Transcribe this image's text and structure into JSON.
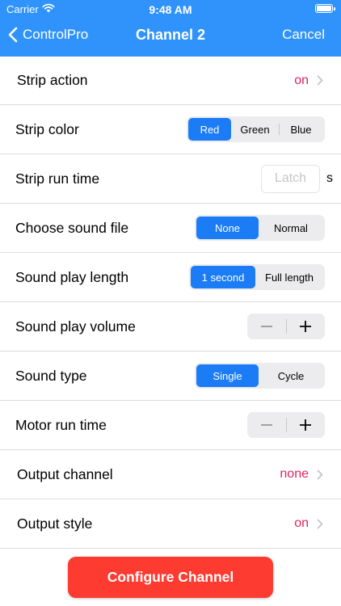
{
  "colors": {
    "header": "#2f93fb",
    "accent": "#1b7cf5",
    "value": "#e0245e",
    "destructive": "#fe3b30"
  },
  "status_bar": {
    "carrier": "Carrier",
    "time": "9:48 AM"
  },
  "nav": {
    "back_label": "ControlPro",
    "title": "Channel 2",
    "cancel_label": "Cancel"
  },
  "rows": {
    "strip_action": {
      "label": "Strip action",
      "value": "on"
    },
    "strip_color": {
      "label": "Strip color",
      "options": [
        "Red",
        "Green",
        "Blue"
      ],
      "selected": "Red"
    },
    "strip_run_time": {
      "label": "Strip run time",
      "placeholder": "Latch",
      "unit": "s"
    },
    "sound_file": {
      "label": "Choose sound file",
      "options": [
        "None",
        "Normal"
      ],
      "selected": "None"
    },
    "sound_length": {
      "label": "Sound play length",
      "options": [
        "1 second",
        "Full length"
      ],
      "selected": "1 second"
    },
    "sound_volume": {
      "label": "Sound play volume",
      "minus": "−",
      "plus": "+"
    },
    "sound_type": {
      "label": "Sound type",
      "options": [
        "Single",
        "Cycle"
      ],
      "selected": "Single"
    },
    "motor_run_time": {
      "label": "Motor run time",
      "minus": "−",
      "plus": "+"
    },
    "output_channel": {
      "label": "Output channel",
      "value": "none"
    },
    "output_style": {
      "label": "Output style",
      "value": "on"
    }
  },
  "footer": {
    "button_label": "Configure Channel"
  }
}
